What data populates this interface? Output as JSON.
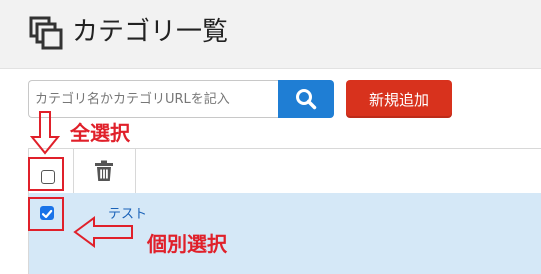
{
  "header": {
    "icon": "copy-stack-icon",
    "title": "カテゴリ一覧"
  },
  "search": {
    "placeholder": "カテゴリ名かカテゴリURLを記入",
    "button_icon": "search-icon"
  },
  "toolbar": {
    "add_label": "新規追加"
  },
  "table": {
    "header_icons": [
      "checkbox-icon",
      "trash-icon"
    ],
    "rows": [
      {
        "label": "テスト",
        "checked": true
      }
    ]
  },
  "annotations": {
    "select_all": "全選択",
    "select_individual": "個別選択"
  },
  "colors": {
    "accent_blue": "#1f7ed4",
    "add_red": "#d8321d",
    "annotation_red": "#e0202a",
    "row_highlight": "#d5e8f7"
  }
}
